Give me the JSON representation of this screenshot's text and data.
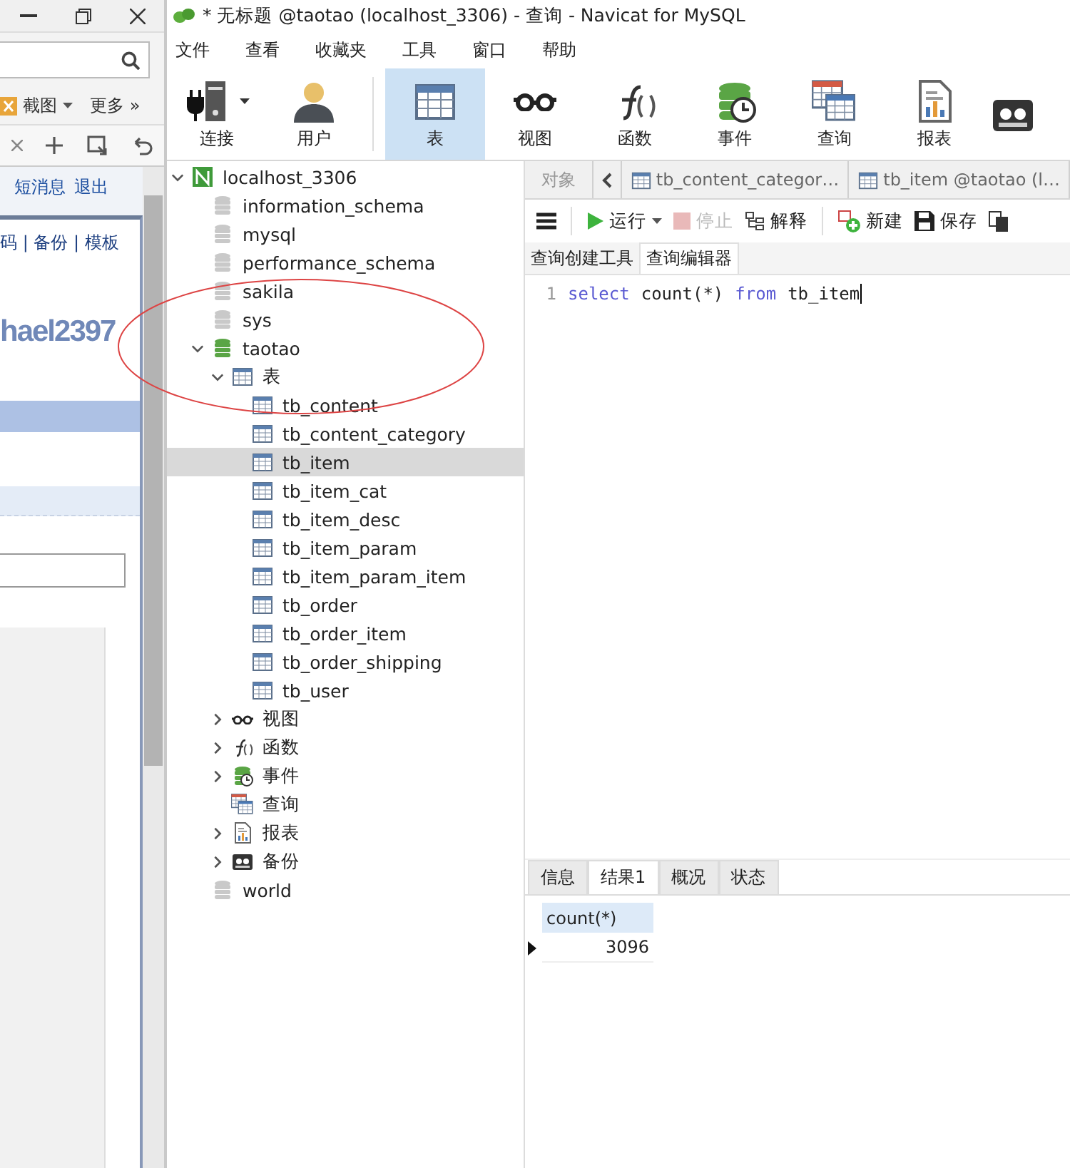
{
  "browser": {
    "toolbar": [
      {
        "kind": "screenshot",
        "label": "截图"
      },
      {
        "kind": "more",
        "label": "更多 »"
      }
    ],
    "links": [
      "短消息",
      "退出"
    ],
    "page": {
      "nav_text": "码 | 备份 | 模板",
      "username": "hael2397"
    }
  },
  "navicat": {
    "title": "* 无标题 @taotao (localhost_3306) - 查询 - Navicat for MySQL",
    "menu": [
      "文件",
      "查看",
      "收藏夹",
      "工具",
      "窗口",
      "帮助"
    ],
    "toolbar": [
      {
        "kind": "connection",
        "label": "连接",
        "selected": false,
        "dropdown": true
      },
      {
        "kind": "user",
        "label": "用户",
        "selected": false,
        "dropdown": false
      },
      {
        "kind": "table",
        "label": "表",
        "selected": true,
        "dropdown": false
      },
      {
        "kind": "view",
        "label": "视图",
        "selected": false,
        "dropdown": false
      },
      {
        "kind": "function",
        "label": "函数",
        "selected": false,
        "dropdown": false
      },
      {
        "kind": "event",
        "label": "事件",
        "selected": false,
        "dropdown": false
      },
      {
        "kind": "query",
        "label": "查询",
        "selected": false,
        "dropdown": false
      },
      {
        "kind": "report",
        "label": "报表",
        "selected": false,
        "dropdown": false
      },
      {
        "kind": "backup",
        "selected": false,
        "dropdown": false
      }
    ],
    "tree": [
      {
        "kind": "server",
        "label": "localhost_3306",
        "expanded": true,
        "selected": false,
        "children": [
          {
            "kind": "database",
            "label": "information_schema",
            "selected": false
          },
          {
            "kind": "database",
            "label": "mysql",
            "selected": false
          },
          {
            "kind": "database",
            "label": "performance_schema",
            "selected": false
          },
          {
            "kind": "database",
            "label": "sakila",
            "selected": false
          },
          {
            "kind": "database",
            "label": "sys",
            "selected": false
          },
          {
            "kind": "database_open",
            "label": "taotao",
            "expanded": true,
            "selected": false,
            "children": [
              {
                "kind": "table_group",
                "label": "表",
                "expanded": true,
                "selected": false,
                "children": [
                  {
                    "kind": "table",
                    "label": "tb_content",
                    "selected": false
                  },
                  {
                    "kind": "table",
                    "label": "tb_content_category",
                    "selected": false
                  },
                  {
                    "kind": "table",
                    "label": "tb_item",
                    "selected": true
                  },
                  {
                    "kind": "table",
                    "label": "tb_item_cat",
                    "selected": false
                  },
                  {
                    "kind": "table",
                    "label": "tb_item_desc",
                    "selected": false
                  },
                  {
                    "kind": "table",
                    "label": "tb_item_param",
                    "selected": false
                  },
                  {
                    "kind": "table",
                    "label": "tb_item_param_item",
                    "selected": false
                  },
                  {
                    "kind": "table",
                    "label": "tb_order",
                    "selected": false
                  },
                  {
                    "kind": "table",
                    "label": "tb_order_item",
                    "selected": false
                  },
                  {
                    "kind": "table",
                    "label": "tb_order_shipping",
                    "selected": false
                  },
                  {
                    "kind": "table",
                    "label": "tb_user",
                    "selected": false
                  }
                ]
              },
              {
                "kind": "view",
                "label": "视图",
                "expanded": false,
                "selected": false
              },
              {
                "kind": "function",
                "label": "函数",
                "expanded": false,
                "selected": false
              },
              {
                "kind": "event",
                "label": "事件",
                "expanded": false,
                "selected": false
              },
              {
                "kind": "query",
                "label": "查询",
                "selected": false
              },
              {
                "kind": "report",
                "label": "报表",
                "expanded": false,
                "selected": false
              },
              {
                "kind": "backup",
                "label": "备份",
                "expanded": false,
                "selected": false
              }
            ]
          },
          {
            "kind": "database",
            "label": "world",
            "selected": false
          }
        ]
      }
    ],
    "object_tabs": [
      {
        "kind": "objects",
        "label": "对象"
      },
      {
        "kind": "table",
        "label": "tb_content_categor…"
      },
      {
        "kind": "table",
        "label": "tb_item @taotao (l…"
      }
    ],
    "query_toolbar": [
      {
        "kind": "menu",
        "disabled": false
      },
      {
        "kind": "run",
        "label": "运行",
        "disabled": false
      },
      {
        "kind": "stop",
        "label": "停止",
        "disabled": true
      },
      {
        "kind": "explain",
        "label": "解释",
        "disabled": false
      },
      {
        "kind": "new",
        "label": "新建",
        "disabled": false
      },
      {
        "kind": "save",
        "label": "保存",
        "disabled": false
      },
      {
        "kind": "copy",
        "disabled": false
      }
    ],
    "editor_tabs": [
      {
        "label": "查询创建工具",
        "selected": false
      },
      {
        "label": "查询编辑器",
        "selected": true
      }
    ],
    "editor": {
      "lines": [
        {
          "number": "1",
          "tokens": [
            {
              "kind": "keyword",
              "text": "select"
            },
            {
              "kind": "plain",
              "text": "count(*)"
            },
            {
              "kind": "keyword",
              "text": "from"
            },
            {
              "kind": "plain",
              "text": "tb_item"
            }
          ]
        }
      ]
    },
    "result_tabs": [
      {
        "label": "信息",
        "selected": false
      },
      {
        "label": "结果1",
        "selected": true
      },
      {
        "label": "概况",
        "selected": false
      },
      {
        "label": "状态",
        "selected": false
      }
    ],
    "result": {
      "columns": [
        "count(*)"
      ],
      "rows": [
        {
          "selected": true,
          "cells": [
            "3096"
          ]
        }
      ]
    }
  }
}
